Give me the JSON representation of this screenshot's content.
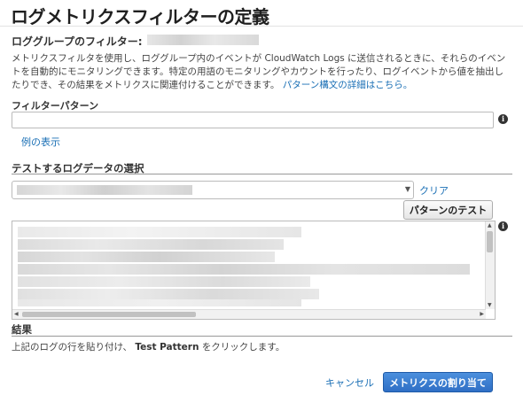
{
  "dialog": {
    "title": "ログメトリクスフィルターの定義",
    "log_group_label": "ロググループのフィルター:",
    "description": "メトリクスフィルタを使用し、ロググループ内のイベントが CloudWatch Logs に送信されるときに、それらのイベントを自動的にモニタリングできます。特定の用語のモニタリングやカウントを行ったり、ログイベントから値を抽出したりでき、その結果をメトリクスに関連付けることができます。",
    "description_link": "パターン構文の詳細はこちら。"
  },
  "filter_pattern": {
    "label": "フィルターパターン",
    "value": "",
    "example_link": "例の表示"
  },
  "test_data": {
    "section_label": "テストするログデータの選択",
    "clear_link": "クリア",
    "test_button": "パターンのテスト"
  },
  "result": {
    "section_label": "結果",
    "text_prefix": "上記のログの行を貼り付け、",
    "text_bold": "Test Pattern",
    "text_suffix": "をクリックします。"
  },
  "footer": {
    "cancel_link": "キャンセル",
    "assign_button": "メトリクスの割り当て"
  },
  "icons": {
    "info": "info-icon",
    "dropdown": "chevron-down-icon"
  },
  "colors": {
    "link": "#1a6fb5",
    "primary_button": "#3a7bd5"
  }
}
